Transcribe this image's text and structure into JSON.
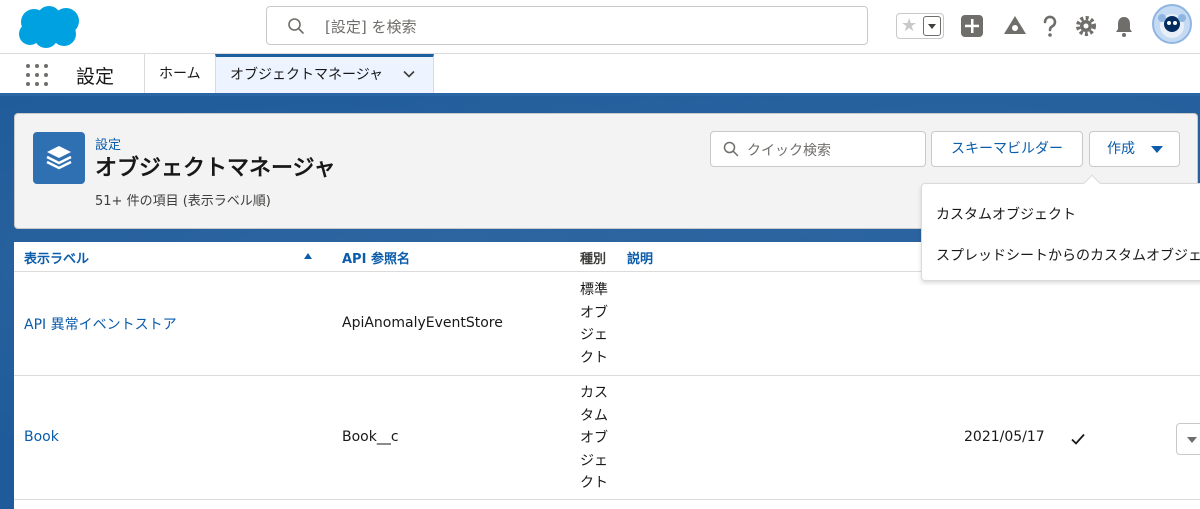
{
  "header": {
    "search_placeholder": "[設定] を検索",
    "icons": [
      "salesforce-logo",
      "favorites-star-icon",
      "add-icon",
      "trailhead-icon",
      "help-icon",
      "setup-gear-icon",
      "notifications-bell-icon",
      "user-avatar"
    ]
  },
  "nav": {
    "app_name": "設定",
    "tabs": [
      {
        "label": "ホーム"
      },
      {
        "label": "オブジェクトマネージャ"
      }
    ]
  },
  "page_header": {
    "breadcrumb": "設定",
    "title": "オブジェクトマネージャ",
    "item_count": "51+ 件の項目 (表示ラベル順)",
    "quick_search_placeholder": "クイック検索",
    "schema_builder_label": "スキーマビルダー",
    "create_label": "作成"
  },
  "create_menu": {
    "items": [
      {
        "label": "カスタムオブジェクト"
      },
      {
        "label": "スプレッドシートからのカスタムオブジェクト"
      }
    ]
  },
  "table": {
    "columns": {
      "label": "表示ラベル",
      "api_name": "API 参照名",
      "type": "種別",
      "description": "説明"
    },
    "rows": [
      {
        "label": "API 異常イベントストア",
        "api_name": "ApiAnomalyEventStore",
        "type": "標準オブジェクト",
        "last_modified": "",
        "deployed": false
      },
      {
        "label": "Book",
        "api_name": "Book__c",
        "type": "カスタムオブジェクト",
        "last_modified": "2021/05/17",
        "deployed": true
      }
    ]
  },
  "colors": {
    "brand_blue": "#0b5cab",
    "band_blue": "#1f5b9a",
    "salesforce_cloud": "#00a1e0"
  }
}
